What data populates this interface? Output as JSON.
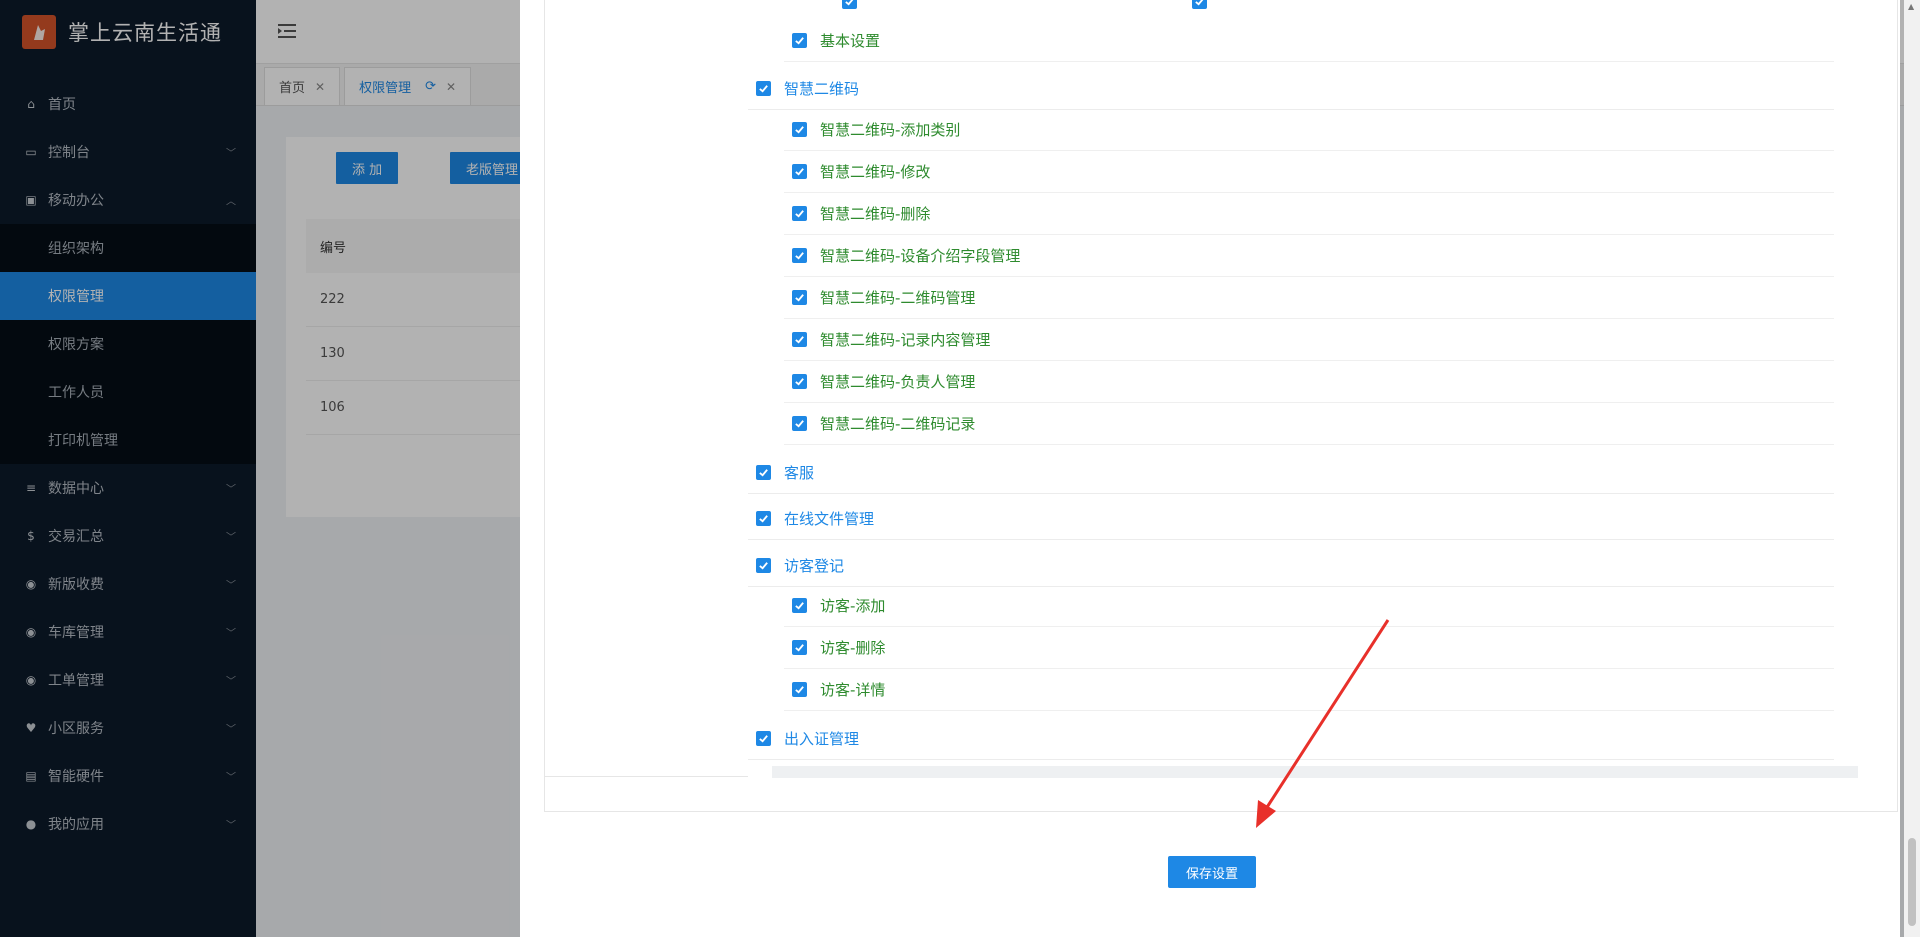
{
  "app": {
    "title": "掌上云南生活通"
  },
  "sidebar": {
    "items": [
      {
        "label": "首页",
        "icon": "home-icon"
      },
      {
        "label": "控制台",
        "icon": "monitor-icon",
        "arrow": "down"
      },
      {
        "label": "移动办公",
        "icon": "briefcase-icon",
        "arrow": "up"
      },
      {
        "label": "数据中心",
        "icon": "database-icon",
        "arrow": "down"
      },
      {
        "label": "交易汇总",
        "icon": "money-bag-icon",
        "arrow": "down"
      },
      {
        "label": "新版收费",
        "icon": "chat-icon",
        "arrow": "down"
      },
      {
        "label": "车库管理",
        "icon": "chat-icon",
        "arrow": "down"
      },
      {
        "label": "工单管理",
        "icon": "chat-icon",
        "arrow": "down"
      },
      {
        "label": "小区服务",
        "icon": "service-icon",
        "arrow": "down"
      },
      {
        "label": "智能硬件",
        "icon": "hardware-icon",
        "arrow": "down"
      },
      {
        "label": "我的应用",
        "icon": "user-icon",
        "arrow": "down"
      }
    ],
    "submenu": [
      {
        "label": "组织架构"
      },
      {
        "label": "权限管理",
        "active": true
      },
      {
        "label": "权限方案"
      },
      {
        "label": "工作人员"
      },
      {
        "label": "打印机管理"
      }
    ]
  },
  "tabs": [
    {
      "label": "首页"
    },
    {
      "label": "权限管理",
      "active": true
    }
  ],
  "content": {
    "add_button": "添 加",
    "old_button": "老版管理",
    "table_header": "编号",
    "rows": [
      "222",
      "130",
      "106"
    ]
  },
  "permissions": [
    {
      "label": "基本设置",
      "level": "child"
    },
    {
      "label": "智慧二维码",
      "level": "parent"
    },
    {
      "label": "智慧二维码-添加类别",
      "level": "child"
    },
    {
      "label": "智慧二维码-修改",
      "level": "child"
    },
    {
      "label": "智慧二维码-删除",
      "level": "child"
    },
    {
      "label": "智慧二维码-设备介绍字段管理",
      "level": "child"
    },
    {
      "label": "智慧二维码-二维码管理",
      "level": "child"
    },
    {
      "label": "智慧二维码-记录内容管理",
      "level": "child"
    },
    {
      "label": "智慧二维码-负责人管理",
      "level": "child"
    },
    {
      "label": "智慧二维码-二维码记录",
      "level": "child"
    },
    {
      "label": "客服",
      "level": "parent"
    },
    {
      "label": "在线文件管理",
      "level": "parent"
    },
    {
      "label": "访客登记",
      "level": "parent"
    },
    {
      "label": "访客-添加",
      "level": "child"
    },
    {
      "label": "访客-删除",
      "level": "child"
    },
    {
      "label": "访客-详情",
      "level": "child"
    },
    {
      "label": "出入证管理",
      "level": "parent"
    }
  ],
  "save_button": "保存设置",
  "colors": {
    "accent": "#1e88e5",
    "child_text": "#2e8b2e",
    "sidebar_bg": "#0c1a2a",
    "annotation": "#e8302a"
  }
}
